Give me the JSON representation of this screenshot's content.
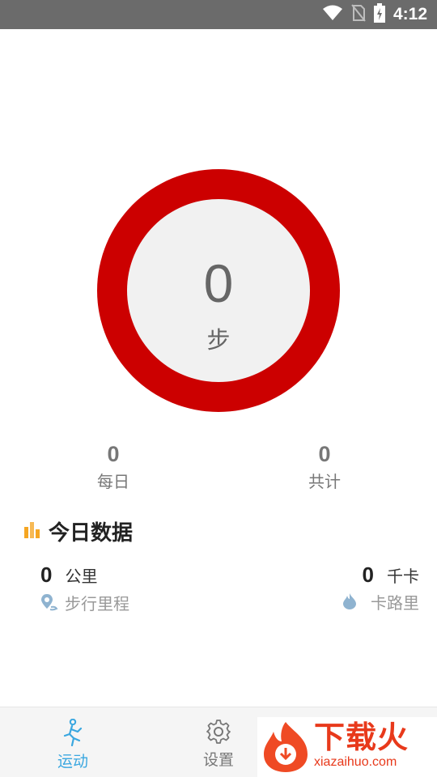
{
  "status_bar": {
    "time": "4:12",
    "icons": [
      "wifi-icon",
      "no-sim-icon",
      "battery-charging-icon"
    ]
  },
  "ring": {
    "steps_value": "0",
    "steps_unit": "步",
    "ring_color": "#cc0000"
  },
  "stats": {
    "daily_value": "0",
    "daily_label": "每日",
    "total_value": "0",
    "total_label": "共计"
  },
  "today": {
    "title": "今日数据",
    "distance_value": "0",
    "distance_unit": "公里",
    "distance_label": "步行里程",
    "calories_value": "0",
    "calories_unit": "千卡",
    "calories_label": "卡路里"
  },
  "bottom_nav": {
    "items": [
      {
        "label": "运动",
        "icon": "running-icon",
        "active": true
      },
      {
        "label": "设置",
        "icon": "gear-icon",
        "active": false
      }
    ],
    "active_color": "#3aa7e0",
    "inactive_color": "#777777"
  },
  "watermark": {
    "text": "下载火",
    "subtext": "xiazaihuo.com"
  }
}
